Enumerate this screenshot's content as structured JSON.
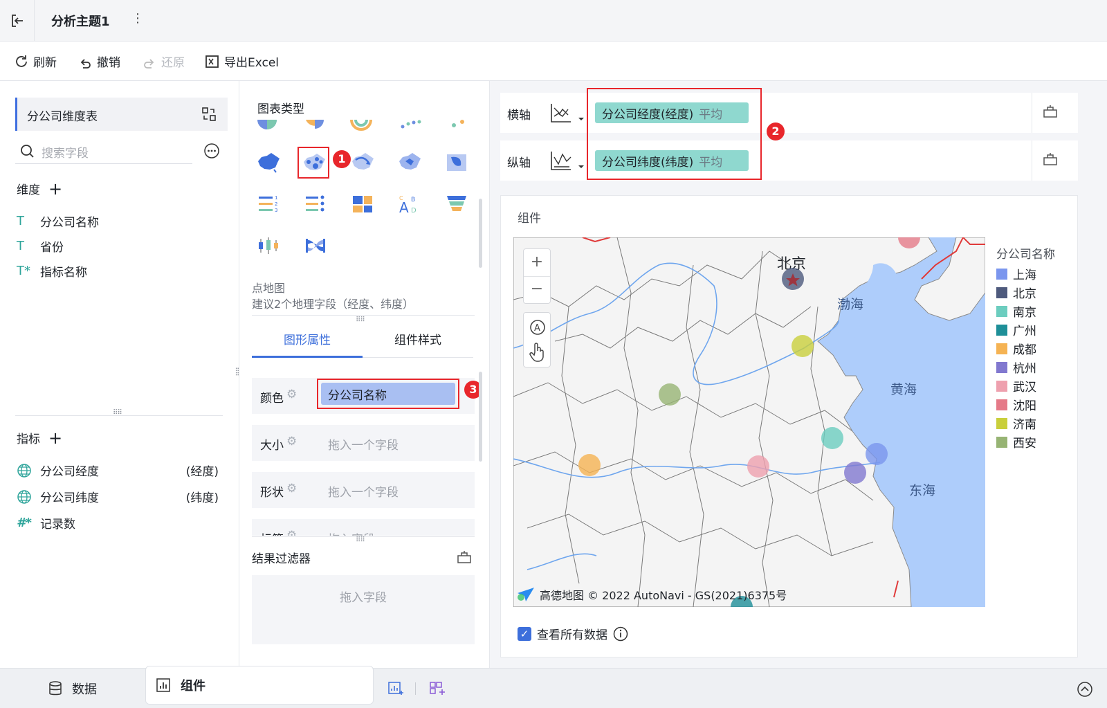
{
  "topbar": {
    "title": "分析主题1",
    "more": "⋮"
  },
  "toolbar": {
    "refresh": "刷新",
    "undo": "撤销",
    "redo": "还原",
    "export": "导出Excel"
  },
  "left": {
    "table_name": "分公司维度表",
    "search_placeholder": "搜索字段",
    "dimensions_title": "维度",
    "dimensions": [
      {
        "type": "T",
        "name": "分公司名称"
      },
      {
        "type": "T",
        "name": "省份"
      },
      {
        "type": "T*",
        "name": "指标名称"
      }
    ],
    "measures_title": "指标",
    "measures": [
      {
        "type": "geo",
        "name": "分公司经度",
        "suffix": "(经度)"
      },
      {
        "type": "geo",
        "name": "分公司纬度",
        "suffix": "(纬度)"
      },
      {
        "type": "#*",
        "name": "记录数",
        "suffix": ""
      }
    ]
  },
  "middle": {
    "chart_type_title": "图表类型",
    "selected_chart_name": "点地图",
    "selected_chart_hint": "建议2个地理字段（经度、纬度）",
    "tabs": [
      "图形属性",
      "组件样式"
    ],
    "props": [
      {
        "label": "颜色",
        "value": "分公司名称",
        "placeholder": ""
      },
      {
        "label": "大小",
        "value": "",
        "placeholder": "拖入一个字段"
      },
      {
        "label": "形状",
        "value": "",
        "placeholder": "拖入一个字段"
      },
      {
        "label": "标签",
        "value": "",
        "placeholder": "拖入字段"
      }
    ],
    "filter_title": "结果过滤器",
    "filter_placeholder": "拖入字段"
  },
  "right": {
    "x_axis_label": "横轴",
    "y_axis_label": "纵轴",
    "x_field": "分公司经度(经度)",
    "x_agg": "平均",
    "y_field": "分公司纬度(纬度)",
    "y_agg": "平均",
    "component_title": "组件",
    "legend_title": "分公司名称",
    "legend": [
      {
        "name": "上海",
        "color": "#7b96ee"
      },
      {
        "name": "北京",
        "color": "#4e5a7d"
      },
      {
        "name": "南京",
        "color": "#6ccdbf"
      },
      {
        "name": "广州",
        "color": "#1e8f98"
      },
      {
        "name": "成都",
        "color": "#f5b353"
      },
      {
        "name": "杭州",
        "color": "#8178cf"
      },
      {
        "name": "武汉",
        "color": "#eea0ae"
      },
      {
        "name": "沈阳",
        "color": "#e57a88"
      },
      {
        "name": "济南",
        "color": "#c9cf3c"
      },
      {
        "name": "西安",
        "color": "#97b474"
      }
    ],
    "map_labels": {
      "beijing": "北京",
      "bohai": "渤海",
      "huanghai": "黄海",
      "donghai": "东海"
    },
    "attribution": "高德地图 © 2022 AutoNavi - GS(2021)6375号",
    "view_all": "查看所有数据",
    "annotations": [
      "1",
      "2",
      "3"
    ]
  },
  "bottom": {
    "tab_data": "数据",
    "tab_component": "组件"
  }
}
